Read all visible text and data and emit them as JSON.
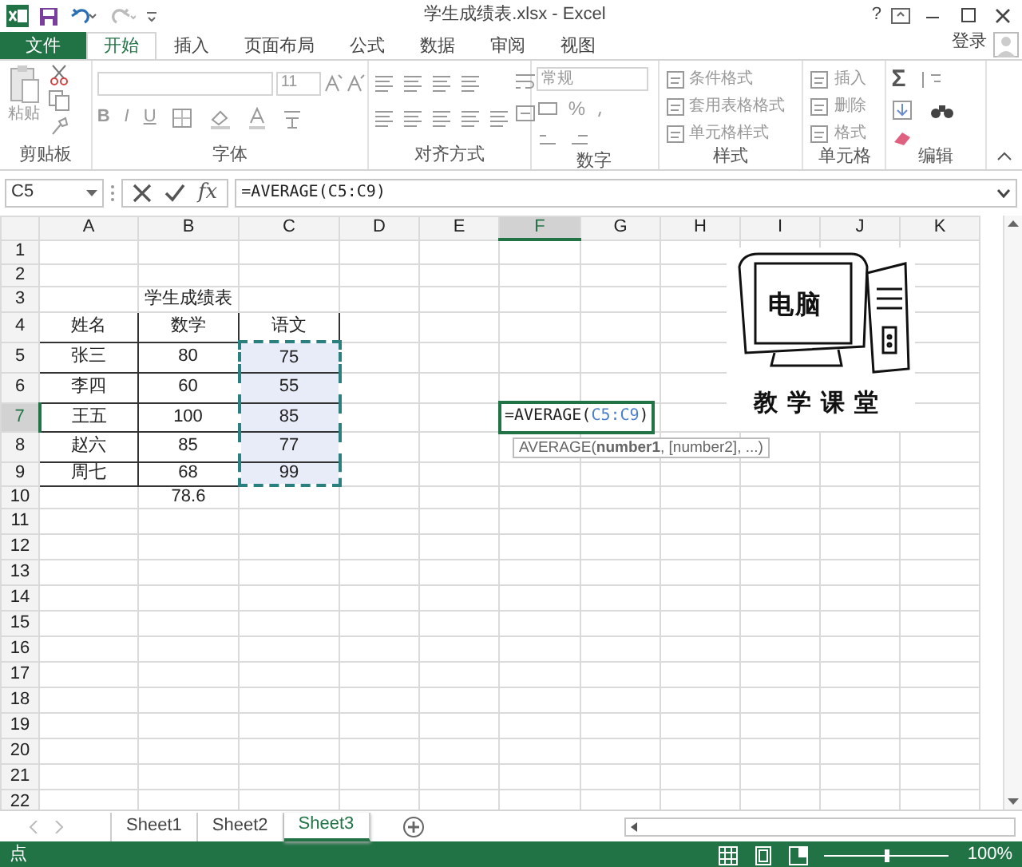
{
  "title_bar": {
    "title": "学生成绩表.xlsx - Excel",
    "help": "?"
  },
  "ribbon_tabs": [
    {
      "label": "文件",
      "kind": "file",
      "selected": false
    },
    {
      "label": "开始",
      "kind": "tab",
      "selected": true
    },
    {
      "label": "插入",
      "kind": "tab",
      "selected": false
    },
    {
      "label": "页面布局",
      "kind": "tab",
      "selected": false
    },
    {
      "label": "公式",
      "kind": "tab",
      "selected": false
    },
    {
      "label": "数据",
      "kind": "tab",
      "selected": false
    },
    {
      "label": "审阅",
      "kind": "tab",
      "selected": false
    },
    {
      "label": "视图",
      "kind": "tab",
      "selected": false
    }
  ],
  "sign_in": "登录",
  "ribbon_groups": [
    {
      "label": "剪贴板",
      "kind": "clipboard",
      "paste": "粘贴"
    },
    {
      "label": "字体",
      "kind": "font",
      "font_size": "11",
      "bold": "B",
      "italic": "I",
      "underline": "U"
    },
    {
      "label": "对齐方式",
      "kind": "alignment"
    },
    {
      "label": "数字",
      "kind": "number",
      "format": "常规",
      "percent": "%"
    },
    {
      "label": "样式",
      "kind": "styles",
      "commands": [
        "条件格式",
        "套用表格格式",
        "单元格样式"
      ]
    },
    {
      "label": "单元格",
      "kind": "cells",
      "commands": [
        "插入",
        "删除",
        "格式"
      ]
    },
    {
      "label": "编辑",
      "kind": "editing",
      "sum": "Σ"
    }
  ],
  "formula_bar": {
    "name_box": "C5",
    "function_label": "fx",
    "formula": "=AVERAGE(C5:C9)"
  },
  "columns": [
    {
      "label": "A",
      "selected": false
    },
    {
      "label": "B",
      "selected": false
    },
    {
      "label": "C",
      "selected": false
    },
    {
      "label": "D",
      "selected": false
    },
    {
      "label": "E",
      "selected": false
    },
    {
      "label": "F",
      "selected": true
    },
    {
      "label": "G",
      "selected": false
    },
    {
      "label": "H",
      "selected": false
    },
    {
      "label": "I",
      "selected": false
    },
    {
      "label": "J",
      "selected": false
    },
    {
      "label": "K",
      "selected": false
    }
  ],
  "rows": [
    {
      "label": "1",
      "selected": false
    },
    {
      "label": "2",
      "selected": false
    },
    {
      "label": "3",
      "selected": false
    },
    {
      "label": "4",
      "selected": false
    },
    {
      "label": "5",
      "selected": false
    },
    {
      "label": "6",
      "selected": false
    },
    {
      "label": "7",
      "selected": true
    },
    {
      "label": "8",
      "selected": false
    },
    {
      "label": "9",
      "selected": false
    },
    {
      "label": "10",
      "selected": false
    },
    {
      "label": "11",
      "selected": false
    },
    {
      "label": "12",
      "selected": false
    },
    {
      "label": "13",
      "selected": false
    },
    {
      "label": "14",
      "selected": false
    },
    {
      "label": "15",
      "selected": false
    },
    {
      "label": "16",
      "selected": false
    },
    {
      "label": "17",
      "selected": false
    },
    {
      "label": "18",
      "selected": false
    },
    {
      "label": "19",
      "selected": false
    },
    {
      "label": "20",
      "selected": false
    },
    {
      "label": "21",
      "selected": false
    },
    {
      "label": "22",
      "selected": false
    }
  ],
  "score_table": {
    "title": "学生成绩表",
    "bordered": true,
    "header": [
      {
        "text": "姓名",
        "in_range": false
      },
      {
        "text": "数学",
        "in_range": false
      },
      {
        "text": "语文",
        "in_range": false
      }
    ],
    "rows": [
      {
        "cells": [
          {
            "text": "张三",
            "in_range": false
          },
          {
            "text": "80",
            "in_range": false
          },
          {
            "text": "75",
            "in_range": true
          }
        ]
      },
      {
        "cells": [
          {
            "text": "李四",
            "in_range": false
          },
          {
            "text": "60",
            "in_range": false
          },
          {
            "text": "55",
            "in_range": true
          }
        ]
      },
      {
        "cells": [
          {
            "text": "王五",
            "in_range": false
          },
          {
            "text": "100",
            "in_range": false
          },
          {
            "text": "85",
            "in_range": true
          }
        ]
      },
      {
        "cells": [
          {
            "text": "赵六",
            "in_range": false
          },
          {
            "text": "85",
            "in_range": false
          },
          {
            "text": "77",
            "in_range": true
          }
        ]
      },
      {
        "cells": [
          {
            "text": "周七",
            "in_range": false
          },
          {
            "text": "68",
            "in_range": false
          },
          {
            "text": "99",
            "in_range": true
          }
        ]
      }
    ],
    "average": "78.6"
  },
  "formula_editor": {
    "before": "=AVERAGE(",
    "reference": "C5:C9",
    "after": ")",
    "tooltip": "AVERAGE(**number1**, [number2], ...)"
  },
  "picture": {
    "top_text": "电脑",
    "bottom_text": "教学课堂"
  },
  "sheet_tabs": [
    {
      "label": "Sheet1",
      "selected": false
    },
    {
      "label": "Sheet2",
      "selected": false
    },
    {
      "label": "Sheet3",
      "selected": true
    }
  ],
  "status_bar": {
    "mode": "点",
    "zoom": "100%"
  }
}
